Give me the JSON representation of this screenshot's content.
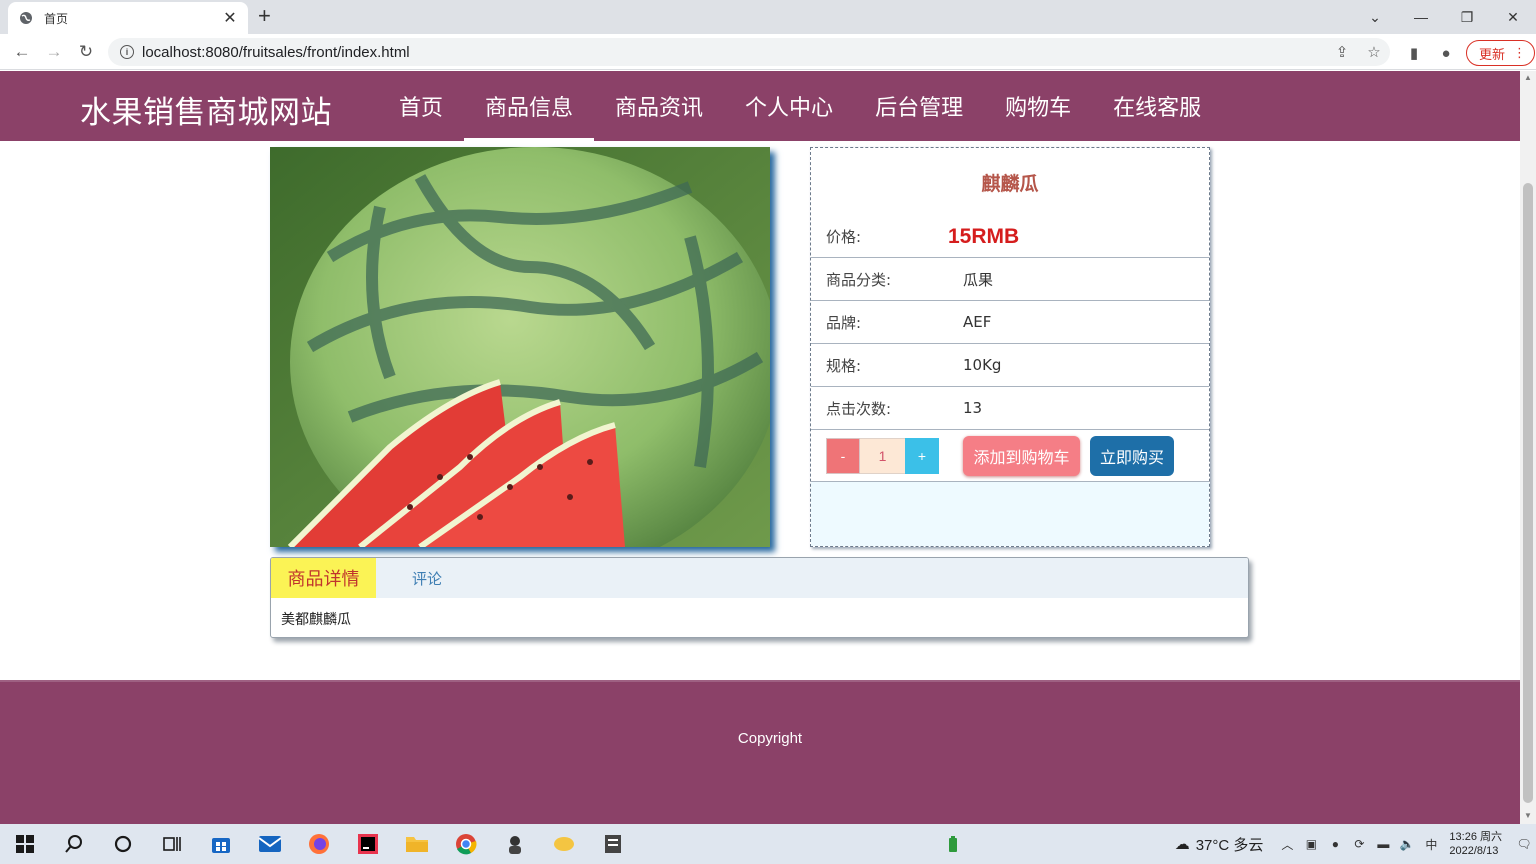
{
  "browser": {
    "tab_title": "首页",
    "url": "localhost:8080/fruitsales/front/index.html",
    "update_label": "更新"
  },
  "site": {
    "title": "水果销售商城网站",
    "nav": [
      {
        "label": "首页",
        "active": false
      },
      {
        "label": "商品信息",
        "active": true
      },
      {
        "label": "商品资讯",
        "active": false
      },
      {
        "label": "个人中心",
        "active": false
      },
      {
        "label": "后台管理",
        "active": false
      },
      {
        "label": "购物车",
        "active": false
      },
      {
        "label": "在线客服",
        "active": false
      }
    ]
  },
  "product": {
    "name": "麒麟瓜",
    "price_label": "价格:",
    "price": "15RMB",
    "category_label": "商品分类:",
    "category": "瓜果",
    "brand_label": "品牌:",
    "brand": "AEF",
    "spec_label": "规格:",
    "spec": "10Kg",
    "clicks_label": "点击次数:",
    "clicks": "13",
    "qty_minus": "-",
    "quantity": "1",
    "qty_plus": "+",
    "add_to_cart": "添加到购物车",
    "buy_now": "立即购买",
    "image_icon": "watermelon-image"
  },
  "details": {
    "tab_details": "商品详情",
    "tab_comments": "评论",
    "text": "美都麒麟瓜"
  },
  "footer": {
    "copyright": "Copyright"
  },
  "taskbar": {
    "weather": "37°C 多云",
    "time": "13:26 周六",
    "date": "2022/8/13"
  },
  "colors": {
    "header_bg": "#8b4168",
    "price": "#d51d1d",
    "name": "#b5564a",
    "tab_active_bg": "#fbf355",
    "buy_now_bg": "#1e6fa8",
    "add_to_cart_bg": "#f57e86"
  }
}
